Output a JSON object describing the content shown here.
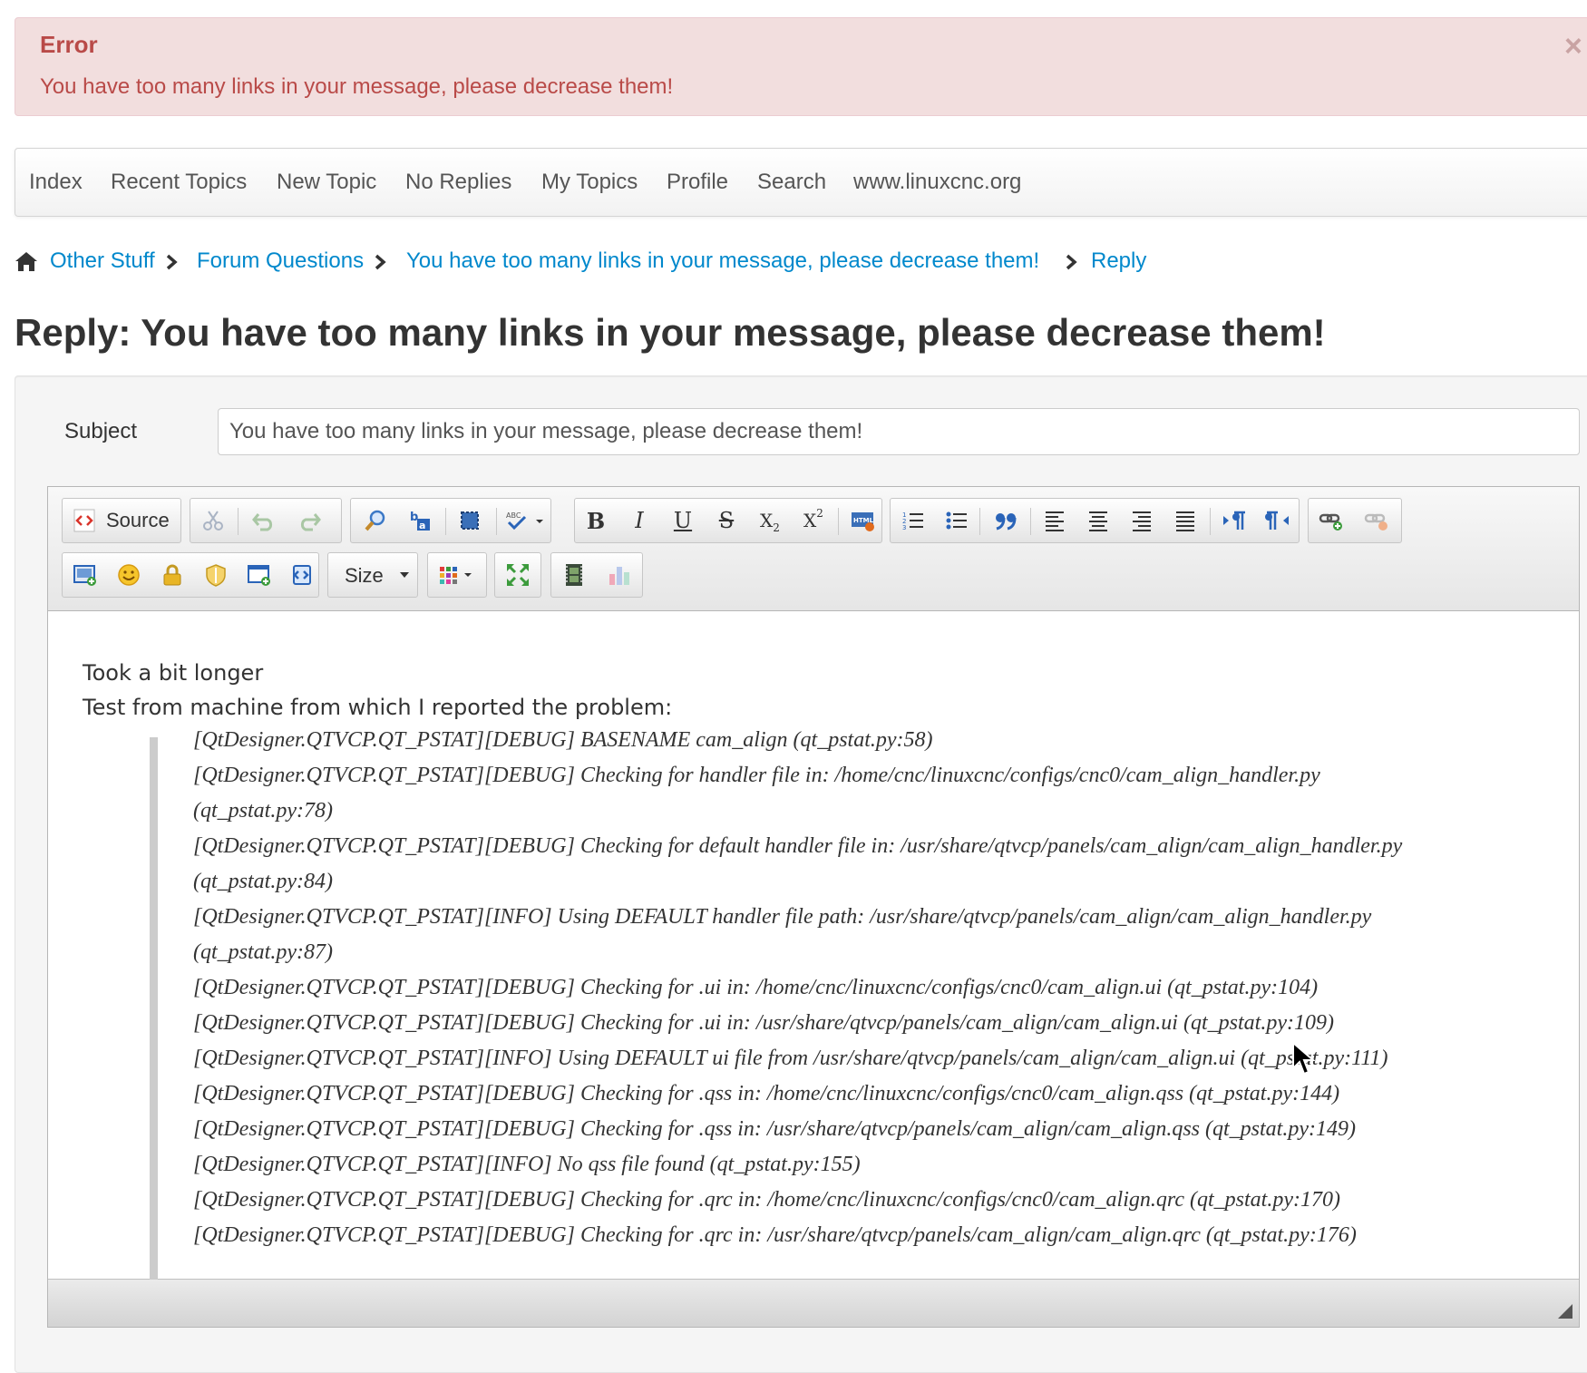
{
  "alert": {
    "title": "Error",
    "message": "You have too many links in your message, please decrease them!",
    "close": "×"
  },
  "nav": {
    "items": [
      "Index",
      "Recent Topics",
      "New Topic",
      "No Replies",
      "My Topics",
      "Profile",
      "Search",
      "www.linuxcnc.org"
    ]
  },
  "breadcrumb": {
    "items": [
      "Other Stuff",
      "Forum Questions",
      "You have too many links in your message, please decrease them!",
      "Reply"
    ]
  },
  "page": {
    "title": "Reply: You have too many links in your message, please decrease them!"
  },
  "form": {
    "subject_label": "Subject",
    "subject_value": "You have too many links in your message, please decrease them!"
  },
  "editor": {
    "source_label": "Source",
    "size_label": "Size",
    "paragraphs": [
      "Took a bit longer",
      "Test from machine from which I reported the problem:"
    ],
    "log_lines": [
      "[QtDesigner.QTVCP.QT_PSTAT][DEBUG]  BASENAME cam_align (qt_pstat.py:58)",
      "[QtDesigner.QTVCP.QT_PSTAT][DEBUG]  Checking for handler file in: /home/cnc/linuxcnc/configs/cnc0/cam_align_handler.py",
      "(qt_pstat.py:78)",
      "[QtDesigner.QTVCP.QT_PSTAT][DEBUG]  Checking for default handler file in: /usr/share/qtvcp/panels/cam_align/cam_align_handler.py",
      "(qt_pstat.py:84)",
      "[QtDesigner.QTVCP.QT_PSTAT][INFO]  Using DEFAULT handler file path: /usr/share/qtvcp/panels/cam_align/cam_align_handler.py",
      "(qt_pstat.py:87)",
      "[QtDesigner.QTVCP.QT_PSTAT][DEBUG]  Checking for .ui in: /home/cnc/linuxcnc/configs/cnc0/cam_align.ui (qt_pstat.py:104)",
      "[QtDesigner.QTVCP.QT_PSTAT][DEBUG]  Checking for .ui in: /usr/share/qtvcp/panels/cam_align/cam_align.ui (qt_pstat.py:109)",
      "[QtDesigner.QTVCP.QT_PSTAT][INFO]  Using DEFAULT ui file from /usr/share/qtvcp/panels/cam_align/cam_align.ui (qt_pstat.py:111)",
      "[QtDesigner.QTVCP.QT_PSTAT][DEBUG]  Checking for .qss in: /home/cnc/linuxcnc/configs/cnc0/cam_align.qss (qt_pstat.py:144)",
      "[QtDesigner.QTVCP.QT_PSTAT][DEBUG]  Checking for .qss in: /usr/share/qtvcp/panels/cam_align/cam_align.qss (qt_pstat.py:149)",
      "[QtDesigner.QTVCP.QT_PSTAT][INFO]  No qss file found (qt_pstat.py:155)",
      "[QtDesigner.QTVCP.QT_PSTAT][DEBUG]  Checking for .qrc in: /home/cnc/linuxcnc/configs/cnc0/cam_align.qrc (qt_pstat.py:170)",
      "[QtDesigner.QTVCP.QT_PSTAT][DEBUG]  Checking for .qrc in: /usr/share/qtvcp/panels/cam_align/cam_align.qrc (qt_pstat.py:176)"
    ]
  },
  "colors": {
    "link": "#0088cc",
    "error_text": "#b94a48",
    "error_bg": "#f2dede"
  }
}
